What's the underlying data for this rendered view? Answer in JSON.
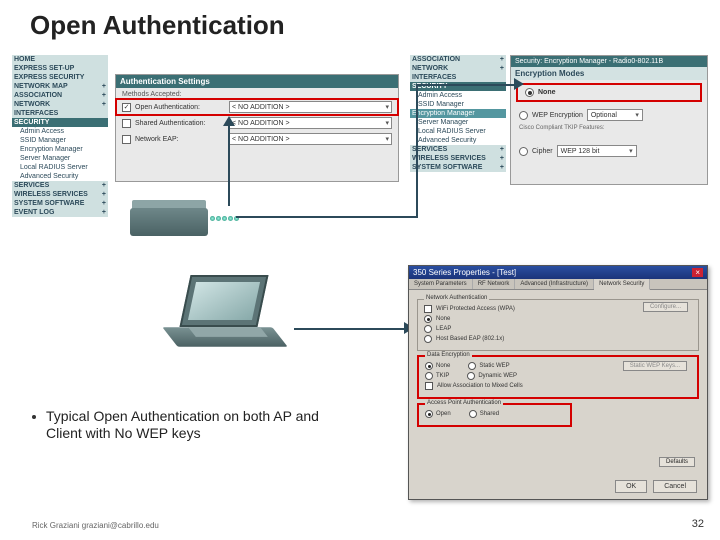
{
  "slide": {
    "title": "Open Authentication",
    "bullet": "Typical Open Authentication on both AP and Client with No WEP keys",
    "footer_left": "Rick Graziani  graziani@cabrillo.edu",
    "page_number": "32"
  },
  "nav_left": {
    "items": [
      {
        "label": "HOME",
        "type": "hdr"
      },
      {
        "label": "EXPRESS SET-UP",
        "type": "hdr"
      },
      {
        "label": "EXPRESS SECURITY",
        "type": "hdr"
      },
      {
        "label": "NETWORK MAP",
        "type": "hdr",
        "plus": "+"
      },
      {
        "label": "ASSOCIATION",
        "type": "hdr",
        "plus": "+"
      },
      {
        "label": "NETWORK",
        "type": "hdr",
        "plus": "+"
      },
      {
        "label": "INTERFACES",
        "type": "hdr"
      },
      {
        "label": "SECURITY",
        "type": "sec"
      },
      {
        "label": "Admin Access",
        "type": "sub"
      },
      {
        "label": "SSID Manager",
        "type": "sub hl"
      },
      {
        "label": "Encryption Manager",
        "type": "sub"
      },
      {
        "label": "Server Manager",
        "type": "sub"
      },
      {
        "label": "Local RADIUS Server",
        "type": "sub"
      },
      {
        "label": "Advanced Security",
        "type": "sub"
      },
      {
        "label": "SERVICES",
        "type": "hdr",
        "plus": "+"
      },
      {
        "label": "WIRELESS SERVICES",
        "type": "hdr",
        "plus": "+"
      },
      {
        "label": "SYSTEM SOFTWARE",
        "type": "hdr",
        "plus": "+"
      },
      {
        "label": "EVENT LOG",
        "type": "hdr",
        "plus": "+"
      }
    ]
  },
  "auth_panel": {
    "title": "Authentication Settings",
    "methods_label": "Methods Accepted:",
    "rows": [
      {
        "cb": true,
        "label": "Open Authentication:",
        "select": "< NO ADDITION >"
      },
      {
        "cb": false,
        "label": "Shared Authentication:",
        "select": "< NO ADDITION >"
      },
      {
        "cb": false,
        "label": "Network EAP:",
        "select": "< NO ADDITION >"
      }
    ]
  },
  "nav_right": {
    "items": [
      {
        "label": "ASSOCIATION",
        "type": "hdr",
        "plus": "+"
      },
      {
        "label": "NETWORK",
        "type": "hdr",
        "plus": "+"
      },
      {
        "label": "INTERFACES",
        "type": "hdr"
      },
      {
        "label": "SECURITY",
        "type": "sec"
      },
      {
        "label": "Admin Access",
        "type": "sub"
      },
      {
        "label": "SSID Manager",
        "type": "sub"
      },
      {
        "label": "Encryption Manager",
        "type": "sel"
      },
      {
        "label": "Server Manager",
        "type": "sub"
      },
      {
        "label": "Local RADIUS Server",
        "type": "sub"
      },
      {
        "label": "Advanced Security",
        "type": "sub"
      },
      {
        "label": "SERVICES",
        "type": "hdr",
        "plus": "+"
      },
      {
        "label": "WIRELESS SERVICES",
        "type": "hdr",
        "plus": "+"
      },
      {
        "label": "SYSTEM SOFTWARE",
        "type": "hdr",
        "plus": "+"
      }
    ]
  },
  "enc_panel": {
    "title": "Security: Encryption Manager - Radio0-802.11B",
    "subtitle": "Encryption Modes",
    "rows": {
      "none": {
        "label": "None",
        "selected": true
      },
      "wep": {
        "label": "WEP Encryption",
        "select": "Optional",
        "hint": "Cisco Compliant TKIP Features:"
      },
      "cipher": {
        "label": "Cipher",
        "select": "WEP 128 bit"
      }
    }
  },
  "client_dialog": {
    "title": "350 Series Properties - [Test]",
    "tabs": [
      "System Parameters",
      "RF Network",
      "Advanced (Infrastructure)",
      "Network Security"
    ],
    "active_tab": 3,
    "group_netauth": {
      "legend": "Network Authentication",
      "wpa_cb": "WiFi Protected Access (WPA)",
      "opts": [
        "None",
        "LEAP",
        "Host Based EAP (802.1x)"
      ],
      "selected": 0,
      "btn_config": "Configure..."
    },
    "group_dataenc": {
      "legend": "Data Encryption",
      "row1": [
        {
          "label": "None",
          "sel": true
        },
        {
          "label": "Static WEP",
          "sel": false
        }
      ],
      "row2": [
        {
          "label": "TKIP",
          "sel": false
        },
        {
          "label": "Dynamic WEP",
          "sel": false
        }
      ],
      "cb_mixed": "Allow Association to Mixed Cells",
      "btn_keys": "Static WEP Keys..."
    },
    "group_apauth": {
      "legend": "Access Point Authentication",
      "opts": [
        {
          "label": "Open",
          "sel": true
        },
        {
          "label": "Shared",
          "sel": false
        }
      ]
    },
    "btn_defaults": "Defaults",
    "btn_ok": "OK",
    "btn_cancel": "Cancel"
  }
}
